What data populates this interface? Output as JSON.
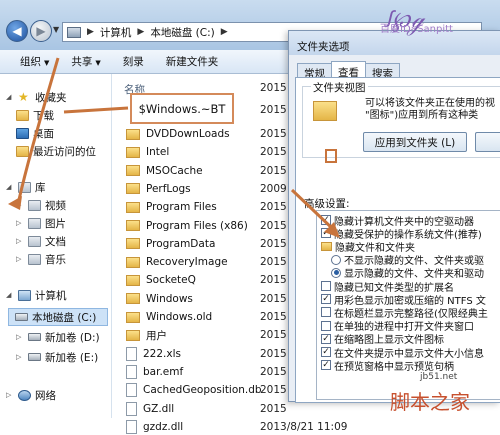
{
  "explorer": {
    "breadcrumb": [
      "计算机",
      "本地磁盘 (C:)"
    ],
    "toolbar": [
      "组织",
      "共享",
      "刻录",
      "新建文件夹"
    ],
    "name_column": "名称",
    "sidebar": [
      {
        "label": "收藏夹",
        "icon": "star-icon"
      },
      {
        "label": "下载",
        "icon": "folder-icon"
      },
      {
        "label": "桌面",
        "icon": "desktop-icon"
      },
      {
        "label": "最近访问的位",
        "icon": "folder-icon"
      },
      {
        "label": "库",
        "icon": "library-icon"
      },
      {
        "label": "视频",
        "icon": "library-icon"
      },
      {
        "label": "图片",
        "icon": "library-icon"
      },
      {
        "label": "文档",
        "icon": "library-icon"
      },
      {
        "label": "音乐",
        "icon": "library-icon"
      },
      {
        "label": "计算机",
        "icon": "computer-icon"
      },
      {
        "label": "本地磁盘 (C:)",
        "icon": "drive-icon"
      },
      {
        "label": "新加卷 (D:)",
        "icon": "drive-icon"
      },
      {
        "label": "新加卷 (E:)",
        "icon": "drive-icon"
      },
      {
        "label": "网络",
        "icon": "network-icon"
      }
    ],
    "highlighted_file": "$Windows.~BT",
    "files": [
      {
        "name": "DVDDownLoads",
        "type": "folder",
        "date": "2015"
      },
      {
        "name": "Intel",
        "type": "folder",
        "date": "2015"
      },
      {
        "name": "MSOCache",
        "type": "folder",
        "date": "2015"
      },
      {
        "name": "PerfLogs",
        "type": "folder",
        "date": "2009"
      },
      {
        "name": "Program Files",
        "type": "folder",
        "date": "2015"
      },
      {
        "name": "Program Files (x86)",
        "type": "folder",
        "date": "2015"
      },
      {
        "name": "ProgramData",
        "type": "folder",
        "date": "2015"
      },
      {
        "name": "RecoveryImage",
        "type": "folder",
        "date": "2015"
      },
      {
        "name": "SocketeQ",
        "type": "folder",
        "date": "2015"
      },
      {
        "name": "Windows",
        "type": "folder",
        "date": "2015"
      },
      {
        "name": "Windows.old",
        "type": "folder",
        "date": "2015"
      },
      {
        "name": "用户",
        "type": "folder",
        "date": "2015"
      },
      {
        "name": "222.xls",
        "type": "file",
        "date": "2015"
      },
      {
        "name": "bar.emf",
        "type": "file",
        "date": "2015"
      },
      {
        "name": "CachedGeoposition.db",
        "type": "file",
        "date": "2015"
      },
      {
        "name": "GZ.dll",
        "type": "file",
        "date": "2015"
      },
      {
        "name": "gzdz.dll",
        "type": "file",
        "date": "2013/8/21 11:09"
      }
    ],
    "dates_top": [
      "2015",
      "2015"
    ]
  },
  "dialog": {
    "title": "文件夹选项",
    "tabs": [
      "常规",
      "查看",
      "搜索"
    ],
    "active_tab": 1,
    "group_label": "文件夹视图",
    "group_text": [
      "可以将该文件夹正在使用的视",
      "\"图标\")应用到所有这种类"
    ],
    "apply_button": "应用到文件夹 (L)",
    "advanced_label": "高级设置:",
    "advanced_items": [
      {
        "kind": "checkbox",
        "checked": true,
        "text": "隐藏计算机文件夹中的空驱动器",
        "indent": 0
      },
      {
        "kind": "checkbox",
        "checked": true,
        "text": "隐藏受保护的操作系统文件(推荐)",
        "indent": 0
      },
      {
        "kind": "folder",
        "checked": false,
        "text": "隐藏文件和文件夹",
        "indent": 0
      },
      {
        "kind": "radio",
        "checked": false,
        "text": "不显示隐藏的文件、文件夹或驱",
        "indent": 1
      },
      {
        "kind": "radio",
        "checked": true,
        "text": "显示隐藏的文件、文件夹和驱动",
        "indent": 1
      },
      {
        "kind": "checkbox",
        "checked": false,
        "text": "隐藏已知文件类型的扩展名",
        "indent": 0
      },
      {
        "kind": "checkbox",
        "checked": true,
        "text": "用彩色显示加密或压缩的 NTFS 文",
        "indent": 0
      },
      {
        "kind": "checkbox",
        "checked": false,
        "text": "在标题栏显示完整路径(仅限经典主",
        "indent": 0
      },
      {
        "kind": "checkbox",
        "checked": false,
        "text": "在单独的进程中打开文件夹窗口",
        "indent": 0
      },
      {
        "kind": "checkbox",
        "checked": true,
        "text": "在缩略图上显示文件图标",
        "indent": 0
      },
      {
        "kind": "checkbox",
        "checked": true,
        "text": "在文件夹提示中显示文件大小信息",
        "indent": 0
      },
      {
        "kind": "checkbox",
        "checked": true,
        "text": "在预览窗格中显示预览句柄",
        "indent": 0
      }
    ]
  },
  "overlay": {
    "watermark": "百度ID: Sanpitt",
    "footer_brand": "脚本之家",
    "footer_url": "jb51.net",
    "highlight_color": "#d48a5a"
  }
}
